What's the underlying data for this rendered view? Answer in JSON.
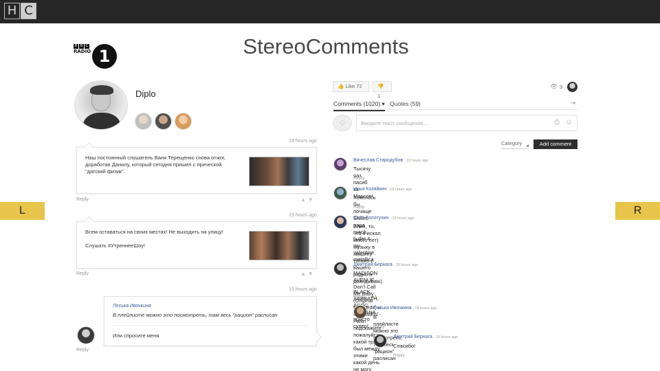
{
  "topbar": {
    "logo_left": "H",
    "logo_right": "C"
  },
  "brand": {
    "bbc_letters": [
      "B",
      "B",
      "C"
    ],
    "radio": "RADIO",
    "channel": "1"
  },
  "page_title": "StereoComments",
  "side_tabs": {
    "left": "L",
    "right": "R"
  },
  "artist": {
    "name": "Diplo"
  },
  "posts": [
    {
      "time": "19 hours ago",
      "lines": [
        "Наш постоянный слушатель Ваня Терещенко снова отжог,",
        "доработав Данилу, который сегодня пришел с прической",
        "\"датский физик\"."
      ],
      "reply": "Reply"
    },
    {
      "time": "19 hours ago",
      "lines": [
        "Всем оставаться на своих местах! Не выходить на улицу!",
        "",
        "Слушать #УтреннееШоу!"
      ],
      "reply": "Reply"
    },
    {
      "time": "19 hours ago",
      "quote_author": "Леська Ивочкина",
      "quote_text": "В плейлисте можно это посмотреть, там весь \"рацион\" расписан",
      "answer": "Или спросите меня",
      "reply": "Reply"
    }
  ],
  "stats": {
    "like_label": "Like",
    "like_count": "72",
    "dislike_count": "1",
    "viewers": "3"
  },
  "tabs": {
    "comments": "Comments (1020)",
    "quotes": "Quotes (59)"
  },
  "composer": {
    "placeholder": "Введите текст сообщения...."
  },
  "category": {
    "label": "Category"
  },
  "add_comment_label": "Add comment",
  "comments": [
    {
      "name": "Вячеслав Стародубов",
      "time": "19 hours ago",
      "lines": [
        "Тысячу раз пасиб за Марсов!"
      ],
      "reply": "Reply"
    },
    {
      "name": "Илья Козяйкин",
      "time": "19 hours ago",
      "lines": [
        "Хотелось бы почаще Skillet, papa roach, bullet 4 my valentine, metallica"
      ],
      "reply": "Reply"
    },
    {
      "name": "Стас Золотухин",
      "time": "19 hours ago",
      "lines": [
        "Блин, то, что я искал много лет) музыку в машину только с вашего радио и",
        "докидываю)",
        "",
        "BLACK SABBATH, ACDC, NIRVANA - просто супер!"
      ],
      "reply": "Reply"
    },
    {
      "name": "Дмитрий Бернага",
      "time": "19 hours ago",
      "lines": [
        "MADISON AVENUE - Don't Call Me Baby (Original Mix - Edit) и PLAYMEN - Fallin",
        "подскажите пожалуйста какой трек был между этими",
        "какой день не могу найти"
      ],
      "reply": "Reply",
      "plus": "+1"
    },
    {
      "name": "Леська Ивочкина",
      "time": "19 hours ago",
      "lines": [
        "В плейлисте можно это посмотреть, там весь \"рацион\" расписан"
      ],
      "reply": "Reply"
    },
    {
      "name": "Дмитрий Бернага",
      "time": "19 hours ago",
      "lines": [
        "Спасибо!"
      ],
      "reply": "Reply"
    }
  ],
  "colors": {
    "accent_tab": "#e8c54a",
    "link_blue": "#3b5a9a",
    "topbar": "#262626"
  }
}
